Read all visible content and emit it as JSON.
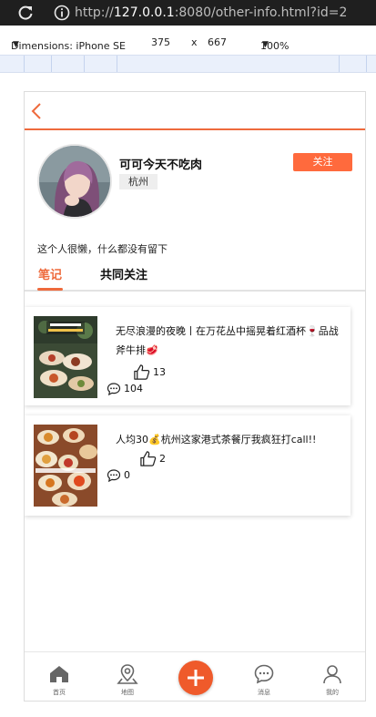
{
  "browser": {
    "url_prefix": "http://",
    "url_host": "127.0.0.1",
    "url_rest": ":8080/other-info.html?id=2"
  },
  "devtools": {
    "dimensions_label": "Dimensions: iPhone SE",
    "width": "375",
    "times": "x",
    "height": "667",
    "zoom": "100%"
  },
  "profile": {
    "nickname": "可可今天不吃肉",
    "city": "杭州",
    "follow_label": "关注",
    "bio": "这个人很懒，什么都没有留下"
  },
  "tabs": [
    {
      "label": "笔记",
      "active": true
    },
    {
      "label": "共同关注",
      "active": false
    }
  ],
  "notes": [
    {
      "title": "无尽浪漫的夜晚丨在万花丛中摇晃着红酒杯🍷品战斧牛排🥩",
      "likes": "13",
      "comments": "104"
    },
    {
      "title": "人均30💰杭州这家港式茶餐厅我疯狂打call!!",
      "likes": "2",
      "comments": "0"
    }
  ],
  "tabbar": [
    {
      "label": "首页",
      "icon": "home-icon"
    },
    {
      "label": "地图",
      "icon": "map-pin-icon"
    },
    {
      "label": "",
      "icon": "plus-icon"
    },
    {
      "label": "消息",
      "icon": "chat-icon"
    },
    {
      "label": "我的",
      "icon": "user-icon"
    }
  ],
  "colors": {
    "accent": "#ee6a3c",
    "follow_button": "#ff6a3d",
    "fab": "#ef5a2b"
  }
}
